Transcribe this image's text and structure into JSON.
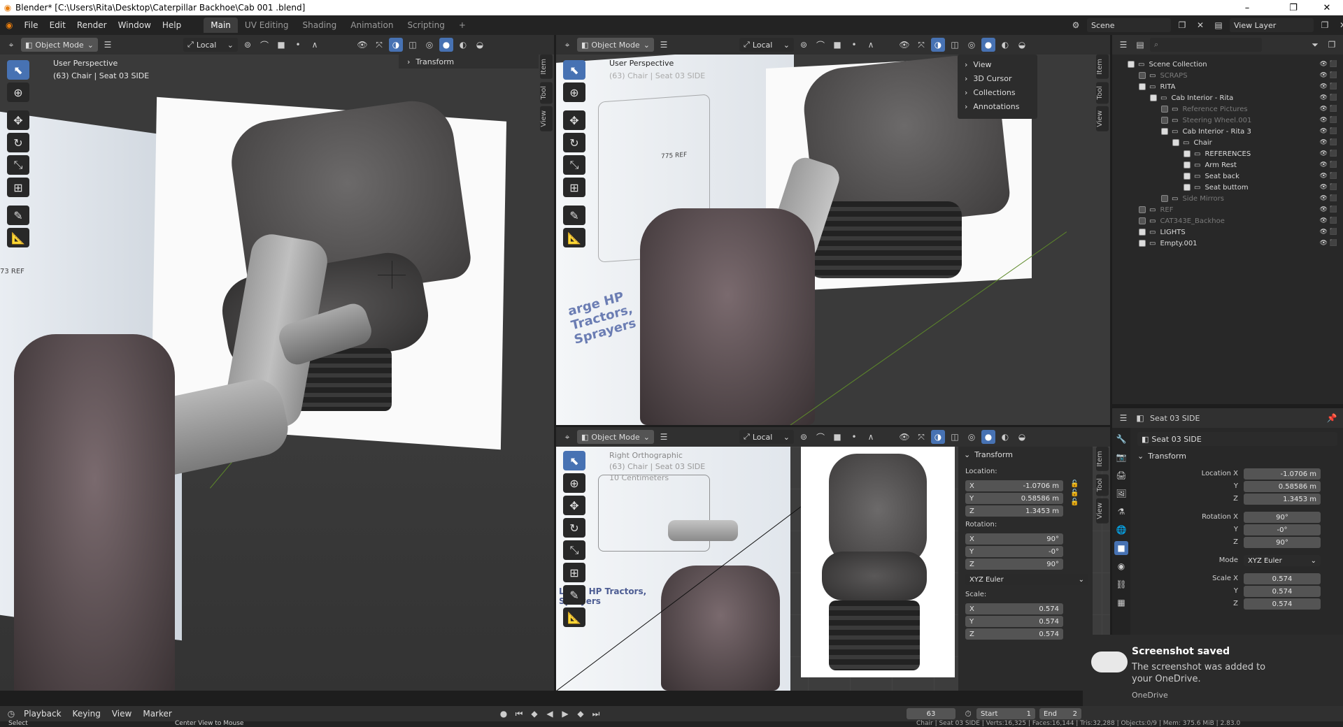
{
  "window": {
    "title": "Blender* [C:\\Users\\Rita\\Desktop\\Caterpillar Backhoe\\Cab 001 .blend]",
    "controls": [
      "–",
      "❐",
      "✕"
    ]
  },
  "menu": {
    "items": [
      "File",
      "Edit",
      "Render",
      "Window",
      "Help"
    ],
    "workspaces": [
      "Main",
      "UV Editing",
      "Shading",
      "Animation",
      "Scripting",
      "+"
    ],
    "scene": "Scene",
    "view_layer": "View Layer"
  },
  "viewport_header": {
    "mode": "Object Mode",
    "orientation": "Local"
  },
  "left_viewport": {
    "view_name": "User Perspective",
    "object_info": "(63) Chair | Seat 03 SIDE",
    "transform_label": "Transform",
    "ref_label": "73 REF",
    "tabs": [
      "Item",
      "Tool",
      "View"
    ]
  },
  "right_top_viewport": {
    "view_name": "User Perspective",
    "object_info": "(63) Chair | Seat 03 SIDE",
    "menu": [
      "View",
      "3D Cursor",
      "Collections",
      "Annotations"
    ],
    "tabs": [
      "Item",
      "Tool",
      "View"
    ],
    "sign_text": "arge HP Tractors, Sprayers",
    "ref_label": "775 REF"
  },
  "right_bottom_viewport": {
    "view_name": "Right Orthographic",
    "object_info": "(63) Chair | Seat 03 SIDE",
    "scale_info": "10 Centimeters",
    "sign_text": "Large HP Tractors, Sprayers",
    "tabs": [
      "Item",
      "Tool",
      "View"
    ],
    "transform": {
      "title": "Transform",
      "location_label": "Location:",
      "location": [
        {
          "axis": "X",
          "value": "-1.0706 m"
        },
        {
          "axis": "Y",
          "value": "0.58586 m"
        },
        {
          "axis": "Z",
          "value": "1.3453 m"
        }
      ],
      "rotation_label": "Rotation:",
      "rotation": [
        {
          "axis": "X",
          "value": "90°"
        },
        {
          "axis": "Y",
          "value": "-0°"
        },
        {
          "axis": "Z",
          "value": "90°"
        }
      ],
      "rotation_mode": "XYZ Euler",
      "scale_label": "Scale:",
      "scale": [
        {
          "axis": "X",
          "value": "0.574"
        },
        {
          "axis": "Y",
          "value": "0.574"
        },
        {
          "axis": "Z",
          "value": "0.574"
        }
      ]
    }
  },
  "outliner": {
    "search_placeholder": "",
    "rows": [
      {
        "label": "Scene Collection",
        "indent": 0,
        "dim": false
      },
      {
        "label": "SCRAPS",
        "indent": 1,
        "dim": true
      },
      {
        "label": "RITA",
        "indent": 1,
        "dim": false
      },
      {
        "label": "Cab Interior - Rita",
        "indent": 2,
        "dim": false
      },
      {
        "label": "Reference Pictures",
        "indent": 3,
        "dim": true
      },
      {
        "label": "Steering Wheel.001",
        "indent": 3,
        "dim": true
      },
      {
        "label": "Cab Interior - Rita 3",
        "indent": 3,
        "dim": false
      },
      {
        "label": "Chair",
        "indent": 4,
        "dim": false
      },
      {
        "label": "REFERENCES",
        "indent": 5,
        "dim": false
      },
      {
        "label": "Arm Rest",
        "indent": 5,
        "dim": false
      },
      {
        "label": "Seat back",
        "indent": 5,
        "dim": false
      },
      {
        "label": "Seat buttom",
        "indent": 5,
        "dim": false
      },
      {
        "label": "Side Mirrors",
        "indent": 3,
        "dim": true
      },
      {
        "label": "REF",
        "indent": 1,
        "dim": true
      },
      {
        "label": "CAT343E_Backhoe",
        "indent": 1,
        "dim": true
      },
      {
        "label": "LIGHTS",
        "indent": 1,
        "dim": false
      },
      {
        "label": "Empty.001",
        "indent": 1,
        "dim": false
      }
    ]
  },
  "properties": {
    "header_object": "Seat 03 SIDE",
    "object_name": "Seat 03 SIDE",
    "section": "Transform",
    "location_x_label": "Location X",
    "rotation_x_label": "Rotation X",
    "mode_label": "Mode",
    "scale_x_label": "Scale X",
    "y_label": "Y",
    "z_label": "Z",
    "location": [
      "-1.0706 m",
      "0.58586 m",
      "1.3453 m"
    ],
    "rotation": [
      "90°",
      "-0°",
      "90°"
    ],
    "mode": "XYZ Euler",
    "scale": [
      "0.574",
      "0.574",
      "0.574"
    ]
  },
  "notification": {
    "title": "Screenshot saved",
    "body": "The screenshot was added to your OneDrive.",
    "source": "OneDrive"
  },
  "timeline": {
    "items": [
      "Playback",
      "Keying",
      "View",
      "Marker"
    ],
    "current_frame": "63",
    "start_label": "Start",
    "start": "1",
    "end_label": "End",
    "end": "2"
  },
  "statusbar": {
    "select": "Select",
    "center": "Center View to Mouse",
    "info": "Chair | Seat 03 SIDE | Verts:16,325 | Faces:16,144 | Tris:32,288 | Objects:0/9 | Mem: 375.6 MiB | 2.83.0"
  }
}
